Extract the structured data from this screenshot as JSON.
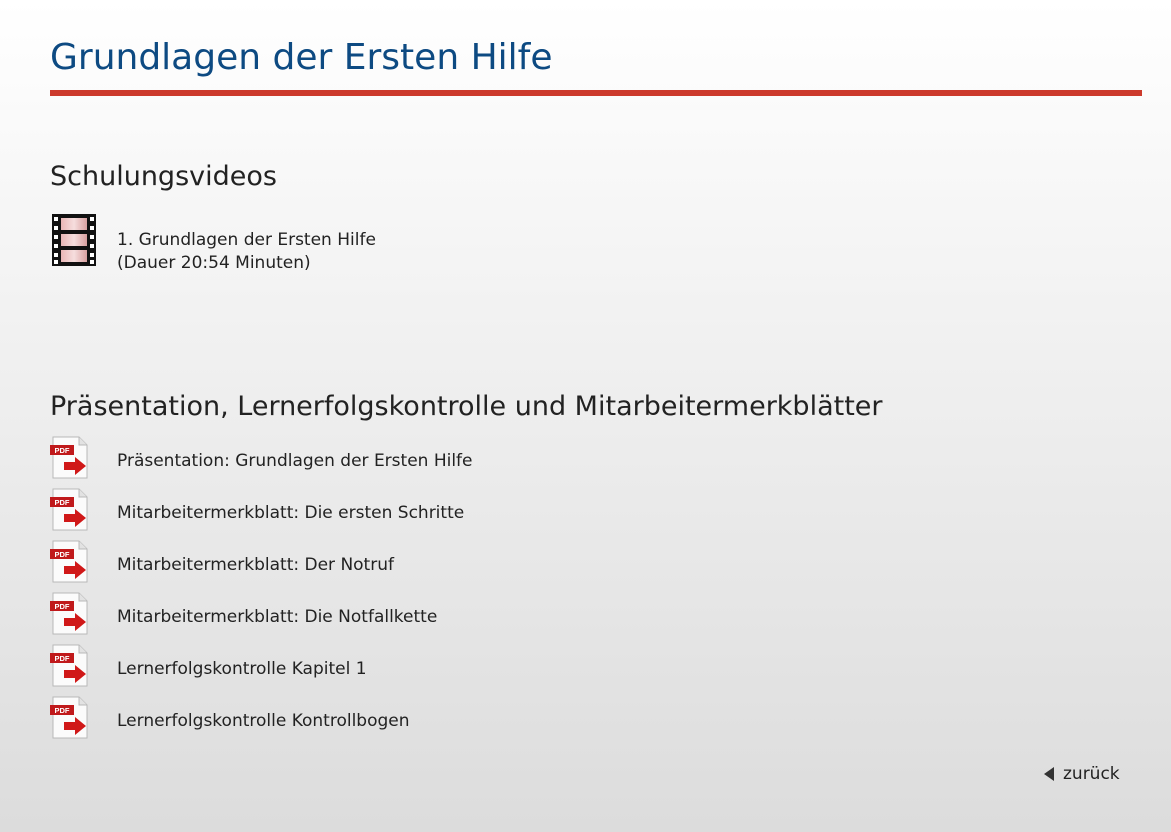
{
  "page": {
    "title": "Grundlagen der Ersten Hilfe"
  },
  "videos": {
    "heading": "Schulungsvideos",
    "items": [
      {
        "title": "1. Grundlagen der Ersten Hilfe",
        "duration": "(Dauer 20:54 Minuten)",
        "icon": "film-strip-icon"
      }
    ]
  },
  "documents": {
    "heading": "Präsentation, Lernerfolgskontrolle und Mitarbeitermerkblätter",
    "icon": "pdf-document-icon",
    "icon_badge": "PDF",
    "items": [
      {
        "label": "Präsentation: Grundlagen der Ersten Hilfe"
      },
      {
        "label": "Mitarbeitermerkblatt: Die ersten Schritte"
      },
      {
        "label": "Mitarbeitermerkblatt: Der Notruf"
      },
      {
        "label": "Mitarbeitermerkblatt: Die Notfallkette"
      },
      {
        "label": "Lernerfolgskontrolle Kapitel 1"
      },
      {
        "label": "Lernerfolgskontrolle Kontrollbogen"
      }
    ]
  },
  "navigation": {
    "back_label": "zurück",
    "back_icon": "triangle-left-icon"
  },
  "colors": {
    "title": "#0d4a82",
    "rule": "#cc3a2c",
    "pdf_badge": "#c0191b",
    "arrow": "#d01818"
  }
}
